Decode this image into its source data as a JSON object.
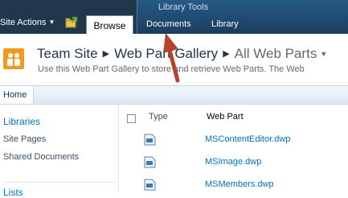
{
  "ribbon": {
    "site_actions": "Site Actions",
    "browse_tab": "Browse",
    "library_tools": {
      "title": "Library Tools",
      "tabs": [
        "Documents",
        "Library"
      ]
    }
  },
  "title_area": {
    "breadcrumb": [
      "Team Site",
      "Web Part Gallery",
      "All Web Parts"
    ],
    "subtitle": "Use this Web Part Gallery to store and retrieve Web Parts. The Web"
  },
  "top_nav": {
    "home": "Home"
  },
  "quick_launch": {
    "libraries_heading": "Libraries",
    "items": [
      "Site Pages",
      "Shared Documents"
    ],
    "lists_heading": "Lists"
  },
  "list_view": {
    "columns": {
      "type": "Type",
      "web_part": "Web Part"
    },
    "rows": [
      {
        "file": "MSContentEditor.dwp"
      },
      {
        "file": "MSImage.dwp"
      },
      {
        "file": "MSMembers.dwp"
      }
    ]
  },
  "colors": {
    "ribbon": "#21374c",
    "contextual_tab": "#275a86",
    "link": "#0072bc",
    "annotation_arrow": "#b5432b"
  },
  "icons": [
    "chevron-down-icon",
    "navigate-up-icon",
    "site-logo-icon",
    "checkbox-icon",
    "web-part-file-icon",
    "red-arrow-annotation"
  ]
}
